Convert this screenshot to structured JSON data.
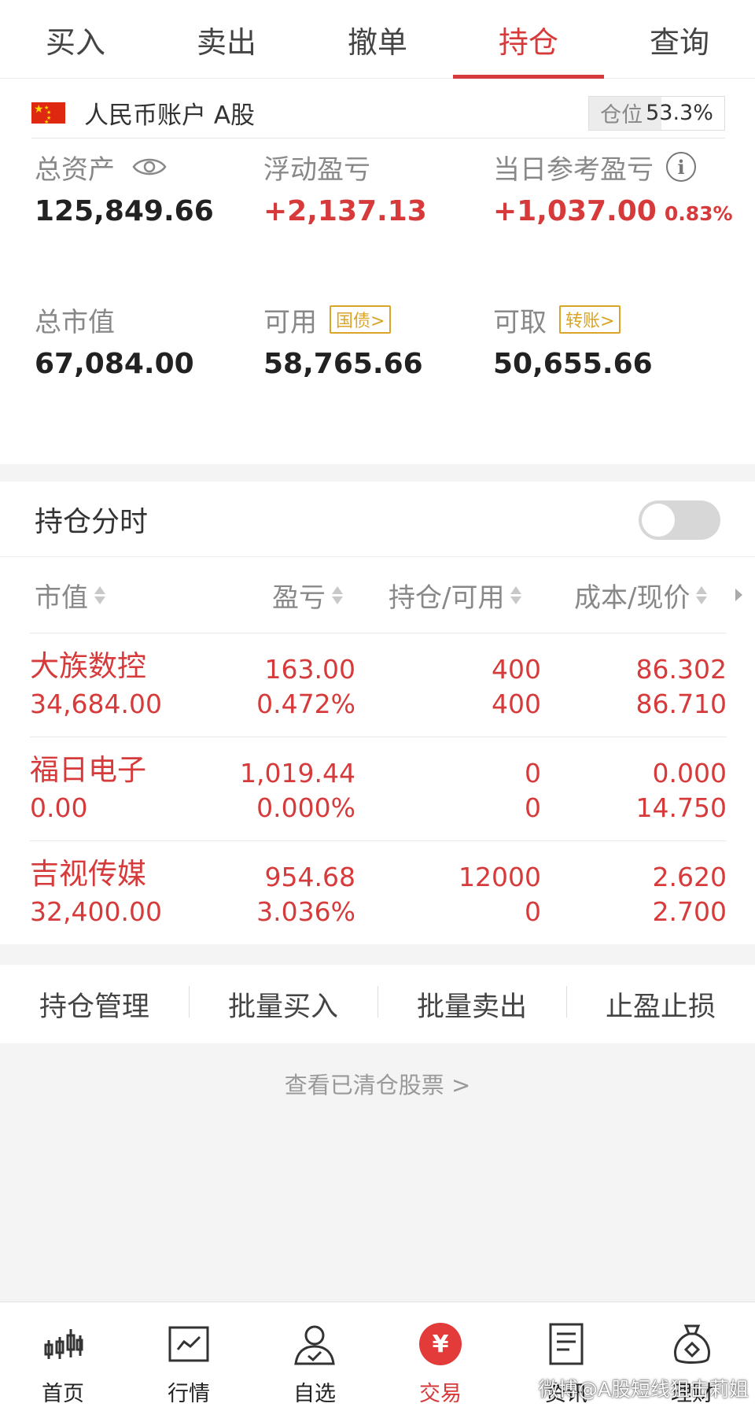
{
  "tabs": [
    {
      "label": "买入"
    },
    {
      "label": "卖出"
    },
    {
      "label": "撤单"
    },
    {
      "label": "持仓"
    },
    {
      "label": "查询"
    }
  ],
  "active_tab": "持仓",
  "account": {
    "name": "人民币账户 A股",
    "position_label": "仓位",
    "position_value": "53.3%",
    "position_fraction": 0.533
  },
  "stats": {
    "total_assets": {
      "label": "总资产",
      "value": "125,849.66"
    },
    "floating_pl": {
      "label": "浮动盈亏",
      "value": "+2,137.13"
    },
    "daily_pl": {
      "label": "当日参考盈亏",
      "value": "+1,037.00",
      "pct": "0.83%"
    },
    "market_value": {
      "label": "总市值",
      "value": "67,084.00"
    },
    "available": {
      "label": "可用",
      "tag": "国债>",
      "value": "58,765.66"
    },
    "withdrawable": {
      "label": "可取",
      "tag": "转账>",
      "value": "50,655.66"
    }
  },
  "holdings": {
    "title": "持仓分时",
    "toggle_on": false,
    "columns": [
      "市值",
      "盈亏",
      "持仓/可用",
      "成本/现价"
    ],
    "rows": [
      {
        "name": "大族数控",
        "market_value": "34,684.00",
        "pl": "163.00",
        "pl_pct": "0.472%",
        "hold": "400",
        "avail": "400",
        "cost": "86.302",
        "price": "86.710"
      },
      {
        "name": "福日电子",
        "market_value": "0.00",
        "pl": "1,019.44",
        "pl_pct": "0.000%",
        "hold": "0",
        "avail": "0",
        "cost": "0.000",
        "price": "14.750"
      },
      {
        "name": "吉视传媒",
        "market_value": "32,400.00",
        "pl": "954.68",
        "pl_pct": "3.036%",
        "hold": "12000",
        "avail": "0",
        "cost": "2.620",
        "price": "2.700"
      }
    ]
  },
  "actions": [
    "持仓管理",
    "批量买入",
    "批量卖出",
    "止盈止损"
  ],
  "cleared_link": "查看已清仓股票 >",
  "bottom_nav": [
    {
      "label": "首页",
      "icon": "candlestick-icon"
    },
    {
      "label": "行情",
      "icon": "chart-line-icon"
    },
    {
      "label": "自选",
      "icon": "user-check-icon"
    },
    {
      "label": "交易",
      "icon": "yuan-icon"
    },
    {
      "label": "资讯",
      "icon": "document-icon"
    },
    {
      "label": "理财",
      "icon": "money-bag-icon"
    }
  ],
  "watermark": "微博@A股短线狙击莉姐",
  "colors": {
    "accent": "#d63a3a",
    "tag": "#d9a427",
    "muted": "#888888"
  }
}
